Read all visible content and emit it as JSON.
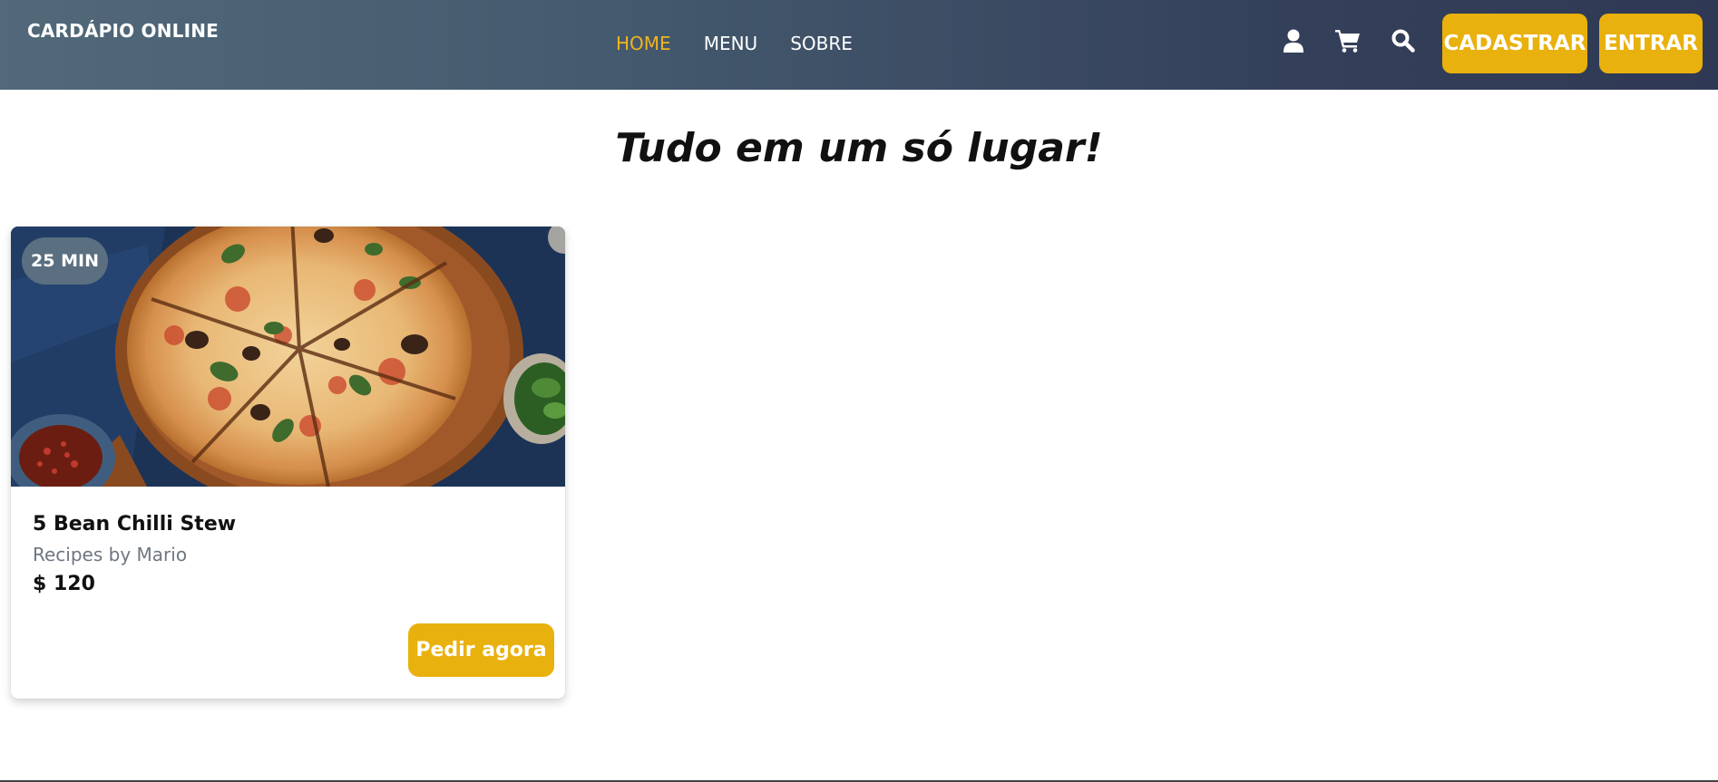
{
  "navbar": {
    "brand": "CARDÁPIO ONLINE",
    "links": [
      {
        "label": "HOME",
        "active": true
      },
      {
        "label": "MENU",
        "active": false
      },
      {
        "label": "SOBRE",
        "active": false
      }
    ],
    "icons": [
      "user-icon",
      "cart-icon",
      "search-icon"
    ],
    "signup_label": "CADASTRAR",
    "login_label": "ENTRAR"
  },
  "main": {
    "title": "Tudo em um só lugar!"
  },
  "card": {
    "time_badge": "25 MIN",
    "title": "5 Bean Chilli Stew",
    "subtitle": "Recipes by Mario",
    "price": "$ 120",
    "order_label": "Pedir agora"
  },
  "colors": {
    "accent": "#e9b10d",
    "active_link": "#f0b420",
    "nav_start": "#52697a",
    "nav_end": "#2f3955"
  }
}
